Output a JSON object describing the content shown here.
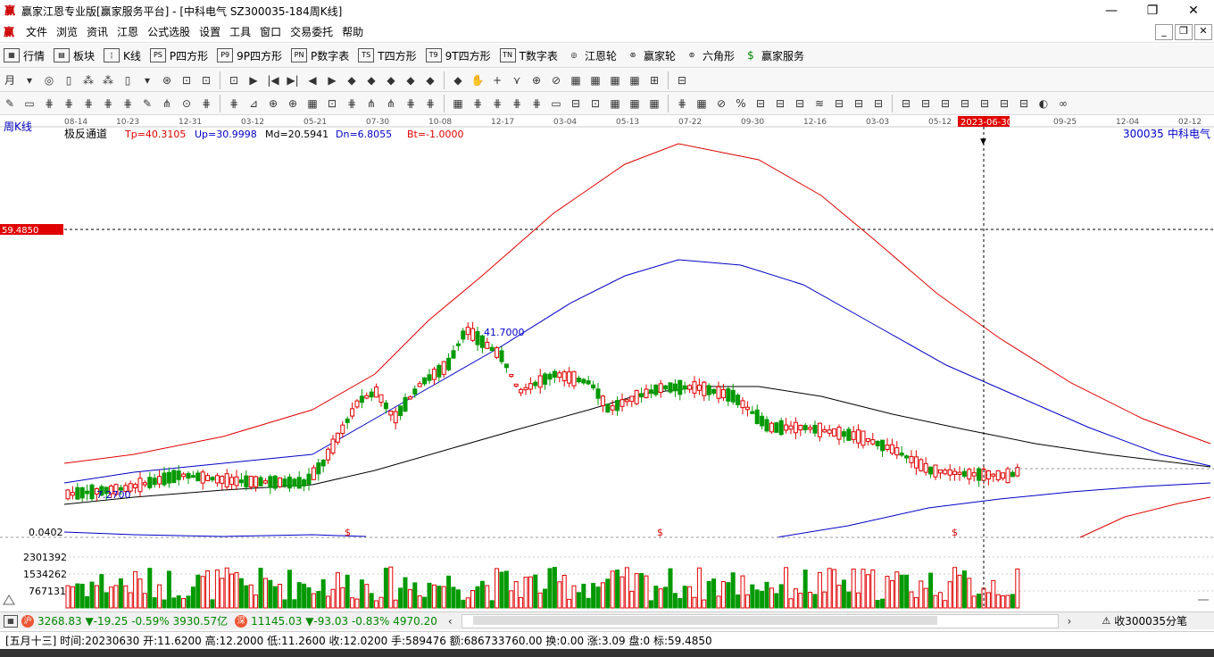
{
  "window": {
    "title": "赢家江恩专业版[赢家服务平台] - [中科电气  SZ300035-184周K线]",
    "app_icon": "赢",
    "controls": [
      "minimize-icon",
      "restore-icon",
      "close-icon"
    ]
  },
  "menu": {
    "items": [
      "文件",
      "浏览",
      "资讯",
      "江恩",
      "公式选股",
      "设置",
      "工具",
      "窗口",
      "交易委托",
      "帮助"
    ]
  },
  "nav": {
    "items": [
      {
        "label": "行情",
        "icon": "▦"
      },
      {
        "label": "板块",
        "icon": "▤"
      },
      {
        "label": "K线",
        "icon": "¦"
      },
      {
        "label": "P四方形",
        "icon": "PS"
      },
      {
        "label": "9P四方形",
        "icon": "P9"
      },
      {
        "label": "P数字表",
        "icon": "PN"
      },
      {
        "label": "T四方形",
        "icon": "TS"
      },
      {
        "label": "9T四方形",
        "icon": "T9"
      },
      {
        "label": "T数字表",
        "icon": "TN"
      },
      {
        "label": "江恩轮",
        "icon": "◎"
      },
      {
        "label": "赢家轮",
        "icon": "⊛"
      },
      {
        "label": "六角形",
        "icon": "⊚"
      },
      {
        "label": "赢家服务",
        "icon": "$"
      }
    ]
  },
  "toolbar1": [
    "月",
    "▾",
    "◎",
    "▯",
    "⁂",
    "⁂",
    "▯",
    "▾",
    "⊛",
    "⊡",
    "⊡",
    "⊡",
    "▶",
    "|◀",
    "▶|",
    "◀",
    "▶",
    "◆",
    "◆",
    "◆",
    "◆",
    "◆",
    "◆",
    "✋",
    "+",
    "⋎",
    "⊕",
    "⊘",
    "▦",
    "▦",
    "▦",
    "▦",
    "⊞",
    "⊟"
  ],
  "toolbar2": [
    "✎",
    "▭",
    "⋕",
    "⋕",
    "⋕",
    "⋕",
    "⋕",
    "✎",
    "⋔",
    "⊙",
    "⋕",
    "⋕",
    "⊿",
    "⊕",
    "⊕",
    "▦",
    "⊡",
    "⋕",
    "⋔",
    "⋔",
    "⋕",
    "⋕",
    "▦",
    "⋕",
    "⋕",
    "⋕",
    "⋕",
    "▭",
    "⊟",
    "⊡",
    "▦",
    "▦",
    "▦",
    "⋕",
    "▦",
    "⊘",
    "%",
    "⊟",
    "⊟",
    "⊟",
    "≋",
    "⊟",
    "⊟",
    "⊟",
    "⊟",
    "⊟",
    "⊟",
    "⊟",
    "⊟",
    "⊟",
    "⊟",
    "◐",
    "∞"
  ],
  "chart": {
    "period_label": "周K线",
    "dates": [
      "08-14",
      "10-23",
      "12-31",
      "03-12",
      "05-21",
      "07-30",
      "10-08",
      "12-17",
      "03-04",
      "05-13",
      "07-22",
      "09-30",
      "12-16",
      "03-03",
      "05-12",
      "2023-06-30",
      "09-25",
      "12-04",
      "02-12"
    ],
    "cursor_date": "2023-06-30",
    "indicator": {
      "name": "极反通道",
      "tp": "Tp=40.3105",
      "up": "Up=30.9998",
      "md": "Md=20.5941",
      "dn": "Dn=6.8055",
      "bt": "Bt=-1.0000"
    },
    "stock": {
      "code": "300035",
      "name": "中科电气"
    },
    "price_label": "59.4850",
    "high_label": "41.7000",
    "low_label": "7.2700",
    "volume_axis": [
      "0.0402",
      "2301392",
      "1534262",
      "767131"
    ],
    "dollar_markers": [
      "$",
      "$",
      "$"
    ],
    "colors": {
      "up": "#e00000",
      "down": "#009900",
      "upper_band": "#e00000",
      "mid_band": "#0000c8",
      "lower_band": "#000000",
      "cursor_badge": "#e00000"
    }
  },
  "status": {
    "sh": {
      "badge": "沪",
      "value": "3268.83",
      "change": "▼-19.25",
      "pct": "-0.59%",
      "amount": "3930.57亿"
    },
    "sz": {
      "badge": "深",
      "value": "11145.03",
      "change": "▼-93.03",
      "pct": "-0.83%",
      "amount": "4970.20"
    },
    "right_label": "收300035分笔"
  },
  "info": {
    "text": "[五月十三] 时间:20230630 开:11.6200 高:12.2000 低:11.2600 收:12.0200 手:589476 额:686733760.00 换:0.00 涨:3.09 盘:0 标:59.4850"
  }
}
